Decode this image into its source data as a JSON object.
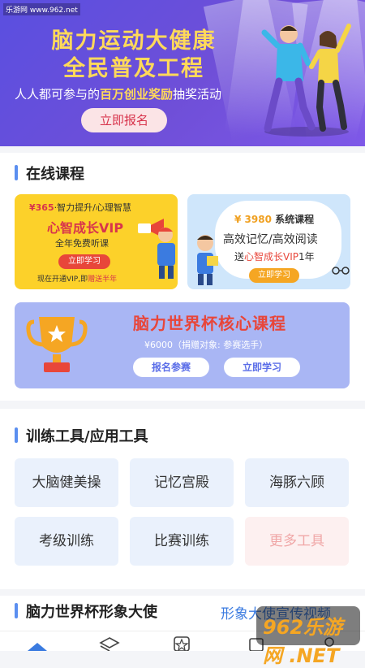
{
  "watermark": "乐游网 www.962.net",
  "hero": {
    "title_line1": "脑力运动大健康",
    "title_line2": "全民普及工程",
    "subtitle_pre": "人人都可参与的",
    "subtitle_highlight": "百万创业奖励",
    "subtitle_post": "抽奖活动",
    "cta": "立即报名"
  },
  "online_courses": {
    "title": "在线课程",
    "card1": {
      "price": "¥365",
      "tagline": "·智力提升/心理智慧",
      "name": "心智成长VIP",
      "desc": "全年免费听课",
      "button": "立即学习",
      "promo_pre": "现在开通VIP,即",
      "promo_hl": "赠送半年"
    },
    "card2": {
      "price": "¥ 3980",
      "name": "系统课程",
      "line1": "高效记忆/高效阅读",
      "line2_pre": "送",
      "line2_hl": "心智成长VIP",
      "line2_post": "1年",
      "button": "立即学习"
    },
    "card3": {
      "title": "脑力世界杯核心课程",
      "price_note": "¥6000（捐赠对象: 参赛选手）",
      "button1": "报名参赛",
      "button2": "立即学习"
    }
  },
  "tools": {
    "title": "训练工具/应用工具",
    "items": [
      "大脑健美操",
      "记忆宫殿",
      "海豚六顾",
      "考级训练",
      "比赛训练",
      "更多工具"
    ]
  },
  "ambassador": {
    "title": "脑力世界杯形象大使",
    "link": "形象大使宣传视频"
  },
  "logo_text": "962乐游网 .NET",
  "colors": {
    "accent": "#5b8ff0",
    "hero_bg": "#5a4fe0",
    "highlight": "#ffd95a",
    "cta_red": "#e8463a"
  }
}
